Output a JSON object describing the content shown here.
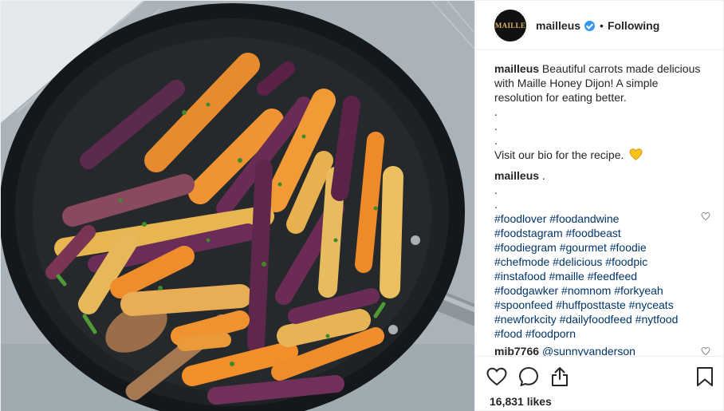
{
  "header": {
    "avatar_text": "MAILLE",
    "username": "mailleus",
    "separator": "•",
    "follow_status": "Following"
  },
  "caption": {
    "username": "mailleus",
    "line1": "Beautiful carrots made delicious",
    "line2": "with Maille Honey Dijon! A simple",
    "line3": "resolution for eating better.",
    "dot1": ".",
    "dot2": ".",
    "dot3": ".",
    "cta": "Visit our bio for the recipe."
  },
  "comment1": {
    "username": "mailleus",
    "text": ".",
    "dot1": ".",
    "dot2": ".",
    "hashtags": [
      "#foodlover #foodandwine",
      "#foodstagram #foodbeast",
      "#foodiegram #gourmet #foodie",
      "#chefmode #delicious #foodpic",
      "#instafood #maille #feedfeed",
      "#foodgawker #nomnom #forkyeah",
      "#spoonfeed #huffposttaste #nyceats",
      "#newforkcity #dailyfoodfeed #nytfood",
      "#food #foodporn"
    ]
  },
  "comment2": {
    "username": "mib7766",
    "text": "@sunnyvanderson"
  },
  "footer": {
    "likes": "16,831 likes"
  },
  "colors": {
    "accent_blue": "#3897f0",
    "hashtag": "#003569",
    "heart_emoji": "#f7c21b",
    "text": "#262626",
    "border": "#efefef"
  },
  "icons": {
    "verified": "verified-badge-icon",
    "emoji": "yellow-heart-emoji",
    "comment_like": "heart-outline-icon",
    "like": "heart-outline-icon",
    "comment": "speech-bubble-icon",
    "share": "share-icon",
    "save": "bookmark-icon"
  }
}
